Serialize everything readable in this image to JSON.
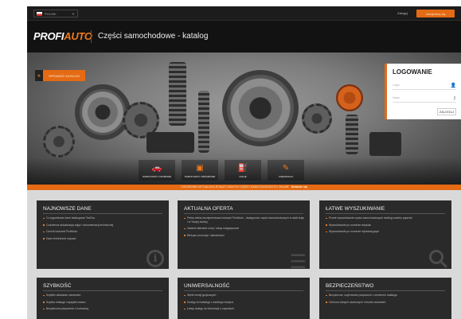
{
  "topbar": {
    "language": "POLSKI",
    "login_link": "Zaloguj",
    "register_button": "Zarejestruj się"
  },
  "header": {
    "logo_part1": "PROFI",
    "logo_part2": "AUTO",
    "title": "Części samochodowe - katalog"
  },
  "hero": {
    "catalog_button": "SPRAWDŹ KATALOG"
  },
  "login": {
    "title": "LOGOWANIE",
    "login_placeholder": "Login",
    "password_placeholder": "Hasło",
    "submit": "ZALOGUJ"
  },
  "categories": [
    {
      "label": "SAMOCHODY OSOBOWE",
      "icon": "car-icon",
      "glyph": "🚗"
    },
    {
      "label": "SAMOCHODY CIĘŻAROWE",
      "icon": "truck-icon",
      "glyph": "▣"
    },
    {
      "label": "OLEJE",
      "icon": "oil-can-icon",
      "glyph": "⛽"
    },
    {
      "label": "CHEMIKALIA",
      "icon": "chemicals-icon",
      "glyph": "✎"
    }
  ],
  "news_strip": {
    "text": "CODZIENNE AKTUALIZACJE BAZY DANYCH CZĘŚCI SAMOCHODOWYCH ONLINE",
    "link": "Dowiedz się"
  },
  "cards": [
    {
      "title": "NAJNOWSZE DANE",
      "items": [
        "Co tygodniowe dane katalogowe TecDoc",
        "Codzienna aktualizacja zdjęć i dokumentacji technicznej",
        "Cennik hurtowni ProfiAuto",
        "Dane techniczne napraw"
      ],
      "icon": "info-icon"
    },
    {
      "title": "AKTUALNA OFERTA",
      "items": [
        "Pełna oferta asortymentowa hurtowni ProfiAuto - dostępność części samochodowych w skali kraju i w Twojej okolicy",
        "Zawsze aktualne ceny i stany magazynowe",
        "Bieżące promocje i aktualności"
      ],
      "icon": "list-icon"
    },
    {
      "title": "ŁATWE WYSZUKIWANIE",
      "items": [
        "Proste wyszukiwanie części samochodowych według modelu pojazdu",
        "Wyszukiwanie po numerze artykułu",
        "Wyszukiwanie po numerze rejestracyjnym"
      ],
      "icon": "search-icon"
    },
    {
      "title": "SZYBKOŚĆ",
      "items": [
        "Szybkie składanie zamówień",
        "Szybka obsługa i wysyłka towaru",
        "Bezpieczne połączenie z hurtownią"
      ],
      "icon": "speed-icon"
    },
    {
      "title": "UNIWERSALNOŚĆ",
      "items": [
        "Wiele wersji językowych",
        "Dostęp do katalogu z każdego miejsca",
        "Łatwy dostęp do informacji o częściach"
      ],
      "icon": "globe-icon"
    },
    {
      "title": "BEZPIECZEŃSTWO",
      "items": [
        "Bezpieczne, szyfrowane połączenie z serwerem katalogu",
        "Ochrona danych osobowych i historii zamówień"
      ],
      "icon": "wrench-icon"
    }
  ],
  "colors": {
    "accent": "#e46a14",
    "dark": "#121212",
    "card": "#2a2a2a"
  }
}
